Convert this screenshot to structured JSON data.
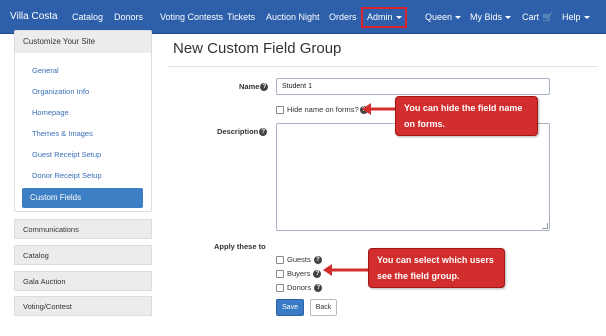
{
  "nav": {
    "brand": "Villa Costa",
    "items": [
      "Catalog",
      "Donors",
      "Voting Contests",
      "Tickets",
      "Auction Night",
      "Orders"
    ],
    "admin": "Admin",
    "queen": "Queen",
    "my_bids": "My Bids",
    "cart": "Cart",
    "help": "Help"
  },
  "sidebar": {
    "section_title": "Customize Your Site",
    "links": [
      "General",
      "Organization Info",
      "Homepage",
      "Themes & Images",
      "Guest Receipt Setup",
      "Donor Receipt Setup"
    ],
    "active": "Custom Fields",
    "sections": [
      "Communications",
      "Catalog",
      "Gala Auction",
      "Voting/Contest"
    ]
  },
  "main": {
    "title": "New Custom Field Group",
    "name_label": "Name",
    "name_value": "Student 1",
    "hide_name_label": "Hide name on forms?",
    "description_label": "Description",
    "apply_label": "Apply these to",
    "options": [
      "Guests",
      "Buyers",
      "Donors"
    ],
    "save_label": "Save",
    "back_label": "Back"
  },
  "callouts": {
    "hide_name": "You can hide the field name on forms.",
    "select_users": "You can select which users see the field group."
  },
  "colors": {
    "nav_bg": "#2d5fab",
    "accent": "#3a7bc8",
    "callout": "#d22e2e",
    "highlight_box": "#e0242b"
  }
}
